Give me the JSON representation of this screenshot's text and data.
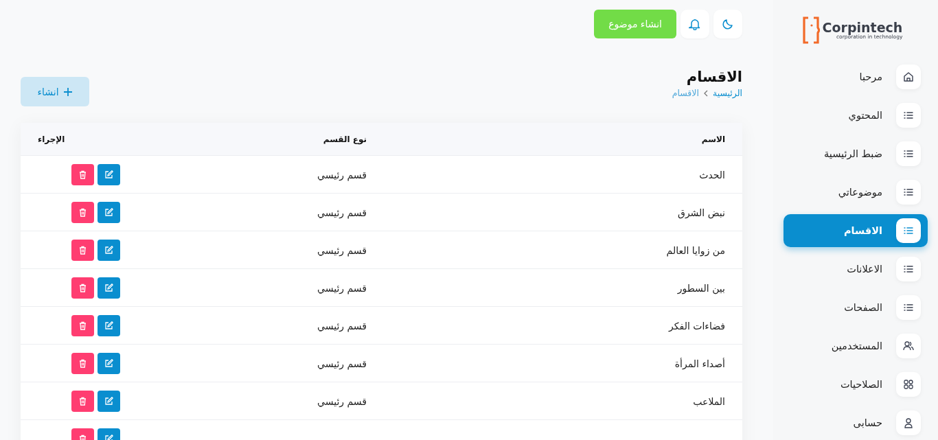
{
  "logo": {
    "name": "Corpintech",
    "tagline": "corporation in technology"
  },
  "sidebar": {
    "items": [
      {
        "label": "مرحبا",
        "kind": "home",
        "selected": false
      },
      {
        "label": "المحتوي",
        "kind": "list",
        "selected": false
      },
      {
        "label": "ضبط الرئيسية",
        "kind": "list",
        "selected": false
      },
      {
        "label": "موضوعاتي",
        "kind": "list",
        "selected": false
      },
      {
        "label": "الاقسام",
        "kind": "list",
        "selected": true
      },
      {
        "label": "الاعلانات",
        "kind": "list",
        "selected": false
      },
      {
        "label": "الصفحات",
        "kind": "list",
        "selected": false
      },
      {
        "label": "المستخدمين",
        "kind": "users",
        "selected": false
      },
      {
        "label": "الصلاحيات",
        "kind": "grid",
        "selected": false
      },
      {
        "label": "حسابى",
        "kind": "user",
        "selected": false
      }
    ]
  },
  "topbar": {
    "create_topic_button": "انشاء موضوع"
  },
  "page": {
    "title": "الاقسام",
    "breadcrumb": [
      {
        "label": "الرئيسية",
        "link": true
      },
      {
        "label": "الاقسام",
        "link": false
      }
    ],
    "create_button": "انشاء"
  },
  "table": {
    "columns": [
      "الاسم",
      "نوع القسم",
      "الإجراء"
    ],
    "rows": [
      {
        "name": "الحدث",
        "type": "قسم رئيسي"
      },
      {
        "name": "نبض الشرق",
        "type": "قسم رئيسي"
      },
      {
        "name": "من زوايا العالم",
        "type": "قسم رئيسي"
      },
      {
        "name": "بين السطور",
        "type": "قسم رئيسي"
      },
      {
        "name": "فضاءات الفكر",
        "type": "قسم رئيسي"
      },
      {
        "name": "أصداء المرأة",
        "type": "قسم رئيسي"
      },
      {
        "name": "الملاعب",
        "type": "قسم رئيسي"
      },
      {}
    ]
  }
}
